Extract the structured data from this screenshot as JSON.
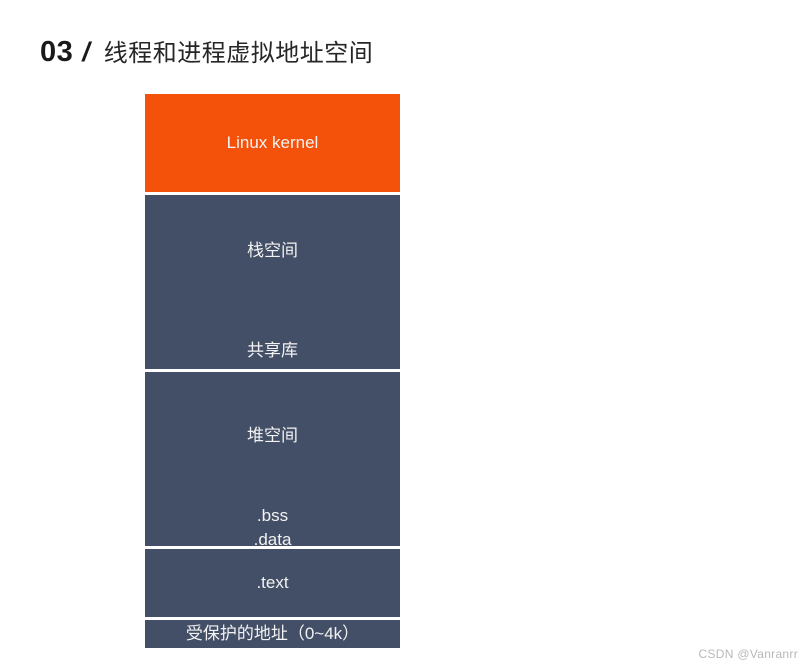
{
  "slide": {
    "number": "03",
    "separator": "/",
    "title": "线程和进程虚拟地址空间"
  },
  "diagram": {
    "name": "process-virtual-address-space",
    "blocks": [
      {
        "id": "kernel",
        "labels": [
          "Linux kernel"
        ],
        "color": "#f4520a",
        "text_color": "#f2f2f2"
      },
      {
        "id": "stack-shared",
        "labels": [
          "栈空间",
          "共享库"
        ],
        "color": "#434f66",
        "text_color": "#f2f2f2"
      },
      {
        "id": "heap-data",
        "labels": [
          "堆空间",
          ".bss",
          ".data"
        ],
        "color": "#434f66",
        "text_color": "#f2f2f2"
      },
      {
        "id": "text-segment",
        "labels": [
          ".text"
        ],
        "color": "#434f66",
        "text_color": "#f2f2f2"
      },
      {
        "id": "protected-address",
        "labels": [
          "受保护的地址（0~4k）"
        ],
        "color": "#434f66",
        "text_color": "#f2f2f2"
      }
    ],
    "label_kernel": "Linux kernel",
    "label_stack": "栈空间",
    "label_shared_library": "共享库",
    "label_heap": "堆空间",
    "label_bss": ".bss",
    "label_data": ".data",
    "label_text": ".text",
    "label_protected": "受保护的地址（0~4k）"
  },
  "watermark": {
    "text": "CSDN @Vanranrr"
  },
  "colors": {
    "kernel_orange": "#f4520a",
    "segment_slate": "#434f66",
    "page_background": "#ffffff",
    "heading_black": "#1a1a1a",
    "label_white": "#f2f2f2",
    "watermark_gray": "#b8b8b8"
  }
}
